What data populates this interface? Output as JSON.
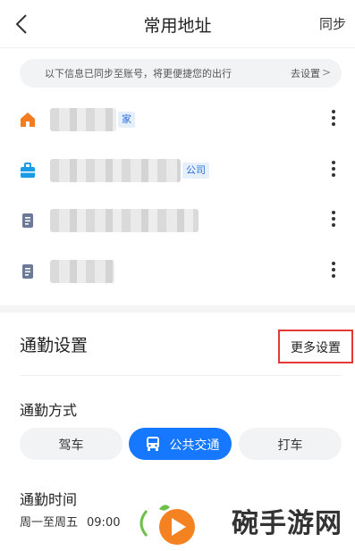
{
  "header": {
    "title": "常用地址",
    "sync_label": "同步"
  },
  "notice": {
    "text": "以下信息已同步至账号，将更便捷您的出行",
    "link": "去设置",
    "chevron": ">"
  },
  "addresses": [
    {
      "icon": "home-icon",
      "tag": "家"
    },
    {
      "icon": "briefcase-icon",
      "tag": "公司"
    },
    {
      "icon": "document-icon",
      "tag": ""
    },
    {
      "icon": "document-icon",
      "tag": ""
    }
  ],
  "commute": {
    "title": "通勤设置",
    "more_settings": "更多设置",
    "mode_label": "通勤方式",
    "modes": [
      "驾车",
      "公共交通",
      "打车"
    ],
    "active_mode": "公共交通",
    "time_label": "通勤时间",
    "days": "周一至周五",
    "time": "09:00"
  },
  "watermark": {
    "text": "碗手游网"
  },
  "colors": {
    "accent": "#1677ff",
    "highlight_box": "#e53935",
    "home_icon": "#f47b20",
    "work_icon": "#1a9be6",
    "doc_icon": "#6b7a99"
  }
}
